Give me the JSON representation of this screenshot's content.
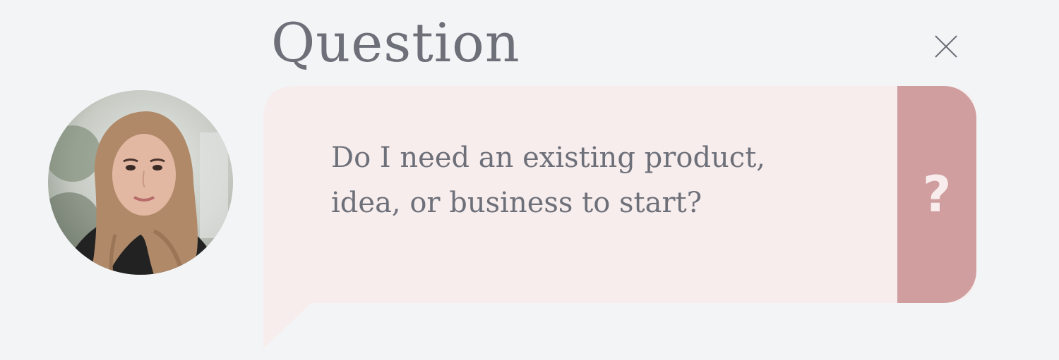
{
  "header": {
    "title": "Question",
    "close_icon": "close-icon"
  },
  "avatar": {
    "icon": "person-photo"
  },
  "question": {
    "text_line1": "Do I need an existing product,",
    "text_line2": "idea, or business to start?",
    "badge_glyph": "?",
    "badge_icon": "question-mark-icon"
  },
  "colors": {
    "background": "#f3f4f6",
    "text": "#6e7079",
    "bubble": "#f7eded",
    "accent": "#d09e9f",
    "accent_glyph": "#f8eced"
  }
}
